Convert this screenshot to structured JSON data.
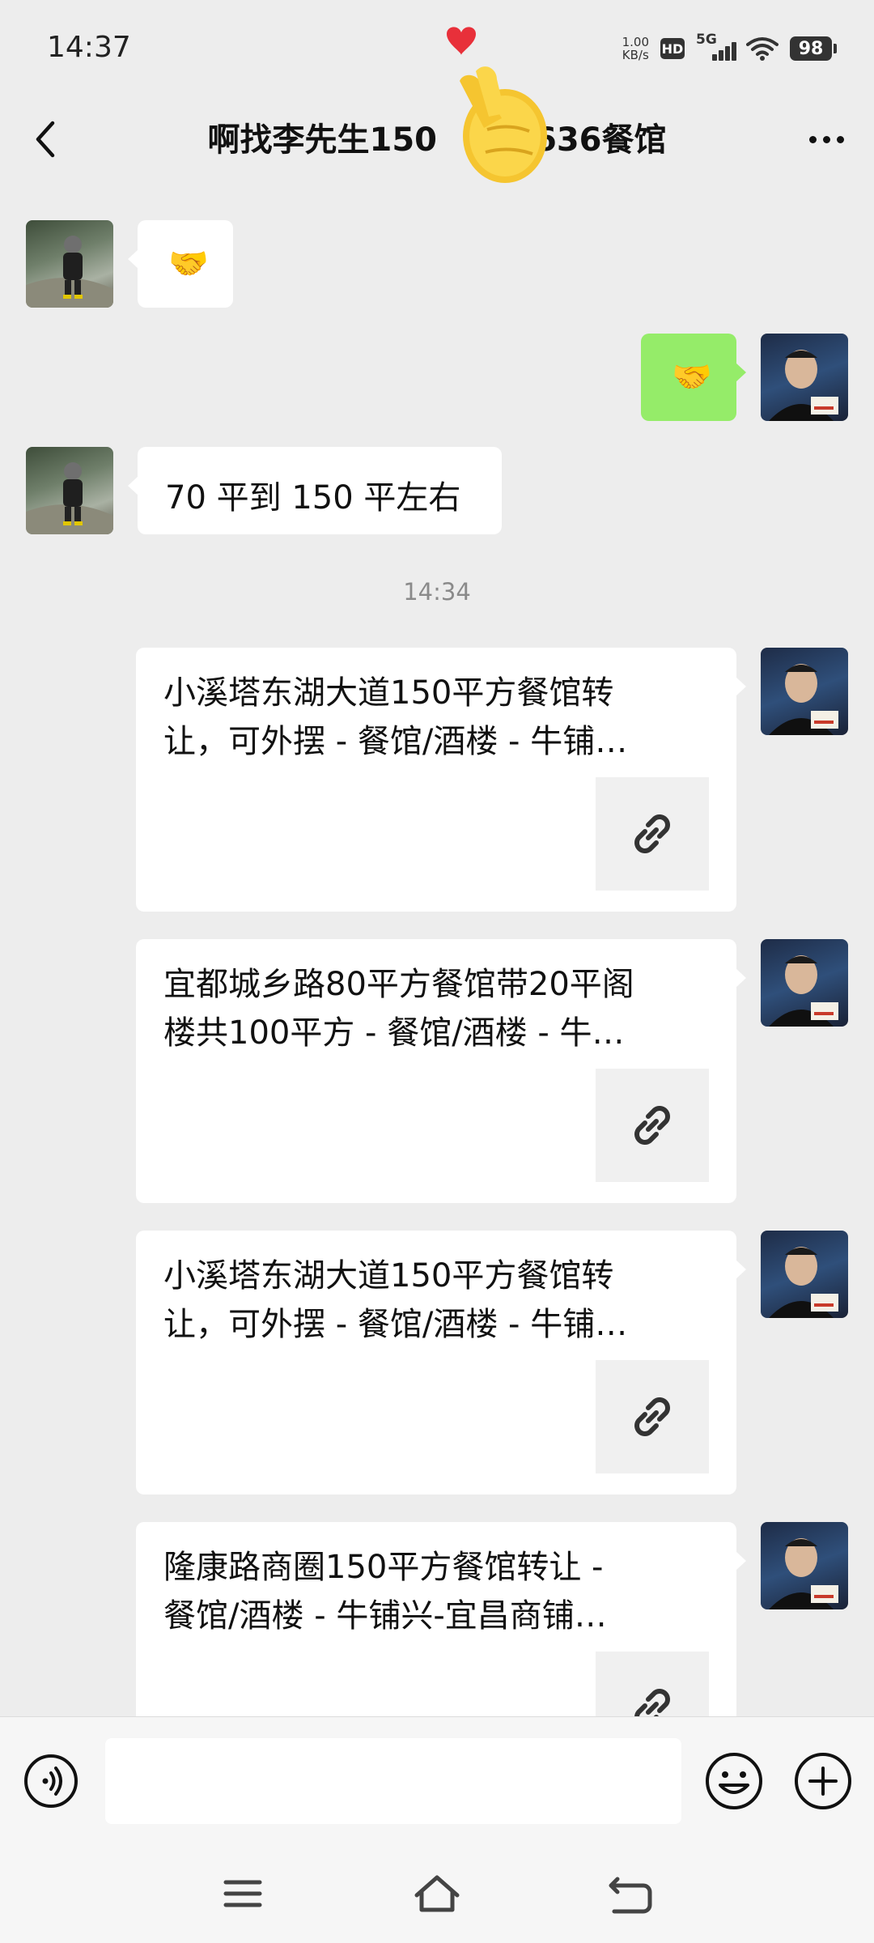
{
  "status_bar": {
    "time": "14:37",
    "net_speed_value": "1.00",
    "net_speed_unit": "KB/s",
    "hd_label": "HD",
    "network_label": "5G",
    "battery": "98"
  },
  "header": {
    "title": "啊找李先生150",
    "title_suffix": "636餐馆"
  },
  "messages": [
    {
      "side": "left",
      "type": "emoji",
      "icon": "handshake-emoji",
      "content": "🤝"
    },
    {
      "side": "right",
      "type": "emoji",
      "icon": "handshake-emoji",
      "content": "🤝"
    },
    {
      "side": "left",
      "type": "text",
      "content": "70 平到 150 平左右"
    },
    {
      "type": "timestamp",
      "content": "14:34"
    },
    {
      "side": "right",
      "type": "link",
      "line1": "小溪塔东湖大道150平方餐馆转",
      "line2": "让，可外摆 - 餐馆/酒楼 - 牛铺…"
    },
    {
      "side": "right",
      "type": "link",
      "line1": "宜都城乡路80平方餐馆带20平阁",
      "line2": "楼共100平方 - 餐馆/酒楼 - 牛…"
    },
    {
      "side": "right",
      "type": "link",
      "line1": "小溪塔东湖大道150平方餐馆转",
      "line2": "让，可外摆 - 餐馆/酒楼 - 牛铺…"
    },
    {
      "side": "right",
      "type": "link",
      "line1": "隆康路商圈150平方餐馆转让 -",
      "line2": "餐馆/酒楼 - 牛铺兴-宜昌商铺…"
    }
  ],
  "input": {
    "value": "",
    "placeholder": ""
  },
  "icons": {
    "back": "chevron-left-icon",
    "more": "more-dots-icon",
    "voice": "voice-icon",
    "emoji": "emoji-face-icon",
    "plus": "plus-icon",
    "link": "link-icon",
    "nav_menu": "menu-icon",
    "nav_home": "home-icon",
    "nav_back": "back-icon"
  },
  "colors": {
    "chat_background": "#ededed",
    "sent_bubble": "#95ec69",
    "received_bubble": "#ffffff"
  }
}
